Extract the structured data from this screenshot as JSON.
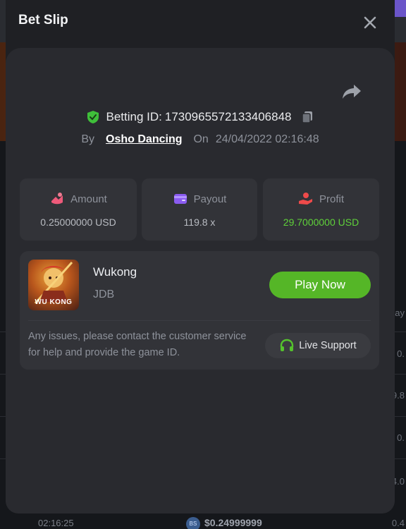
{
  "modal": {
    "title": "Bet Slip",
    "betting_id_label": "Betting ID:",
    "betting_id": "1730965572133406848",
    "by_label": "By",
    "user": "Osho Dancing",
    "on_label": "On",
    "datetime": "24/04/2022 02:16:48"
  },
  "stats": [
    {
      "label": "Amount",
      "value": "0.25000000 USD",
      "color": "#ee5a7a"
    },
    {
      "label": "Payout",
      "value": "119.8 x",
      "color": "#8a5bf0"
    },
    {
      "label": "Profit",
      "value": "29.7000000 USD",
      "color": "#ee4a4a",
      "value_color": "#5fd13a"
    }
  ],
  "game": {
    "name": "Wukong",
    "provider": "JDB",
    "thumb_text": "WU KONG",
    "play_label": "Play Now",
    "note": "Any issues, please contact the customer service for help and provide the game ID.",
    "support_label": "Live Support"
  },
  "background": {
    "bottom_time": "02:16:25",
    "bottom_badge": "BS",
    "bottom_amount": "$0.24999999",
    "right_texts": [
      "ay",
      "0.",
      "9.8",
      "0.",
      "4.0",
      "0.4"
    ]
  },
  "colors": {
    "accent_green": "#55b627",
    "shield_green": "#3fbf3a",
    "modal_bg": "#1f2024",
    "card_bg": "#323338"
  }
}
